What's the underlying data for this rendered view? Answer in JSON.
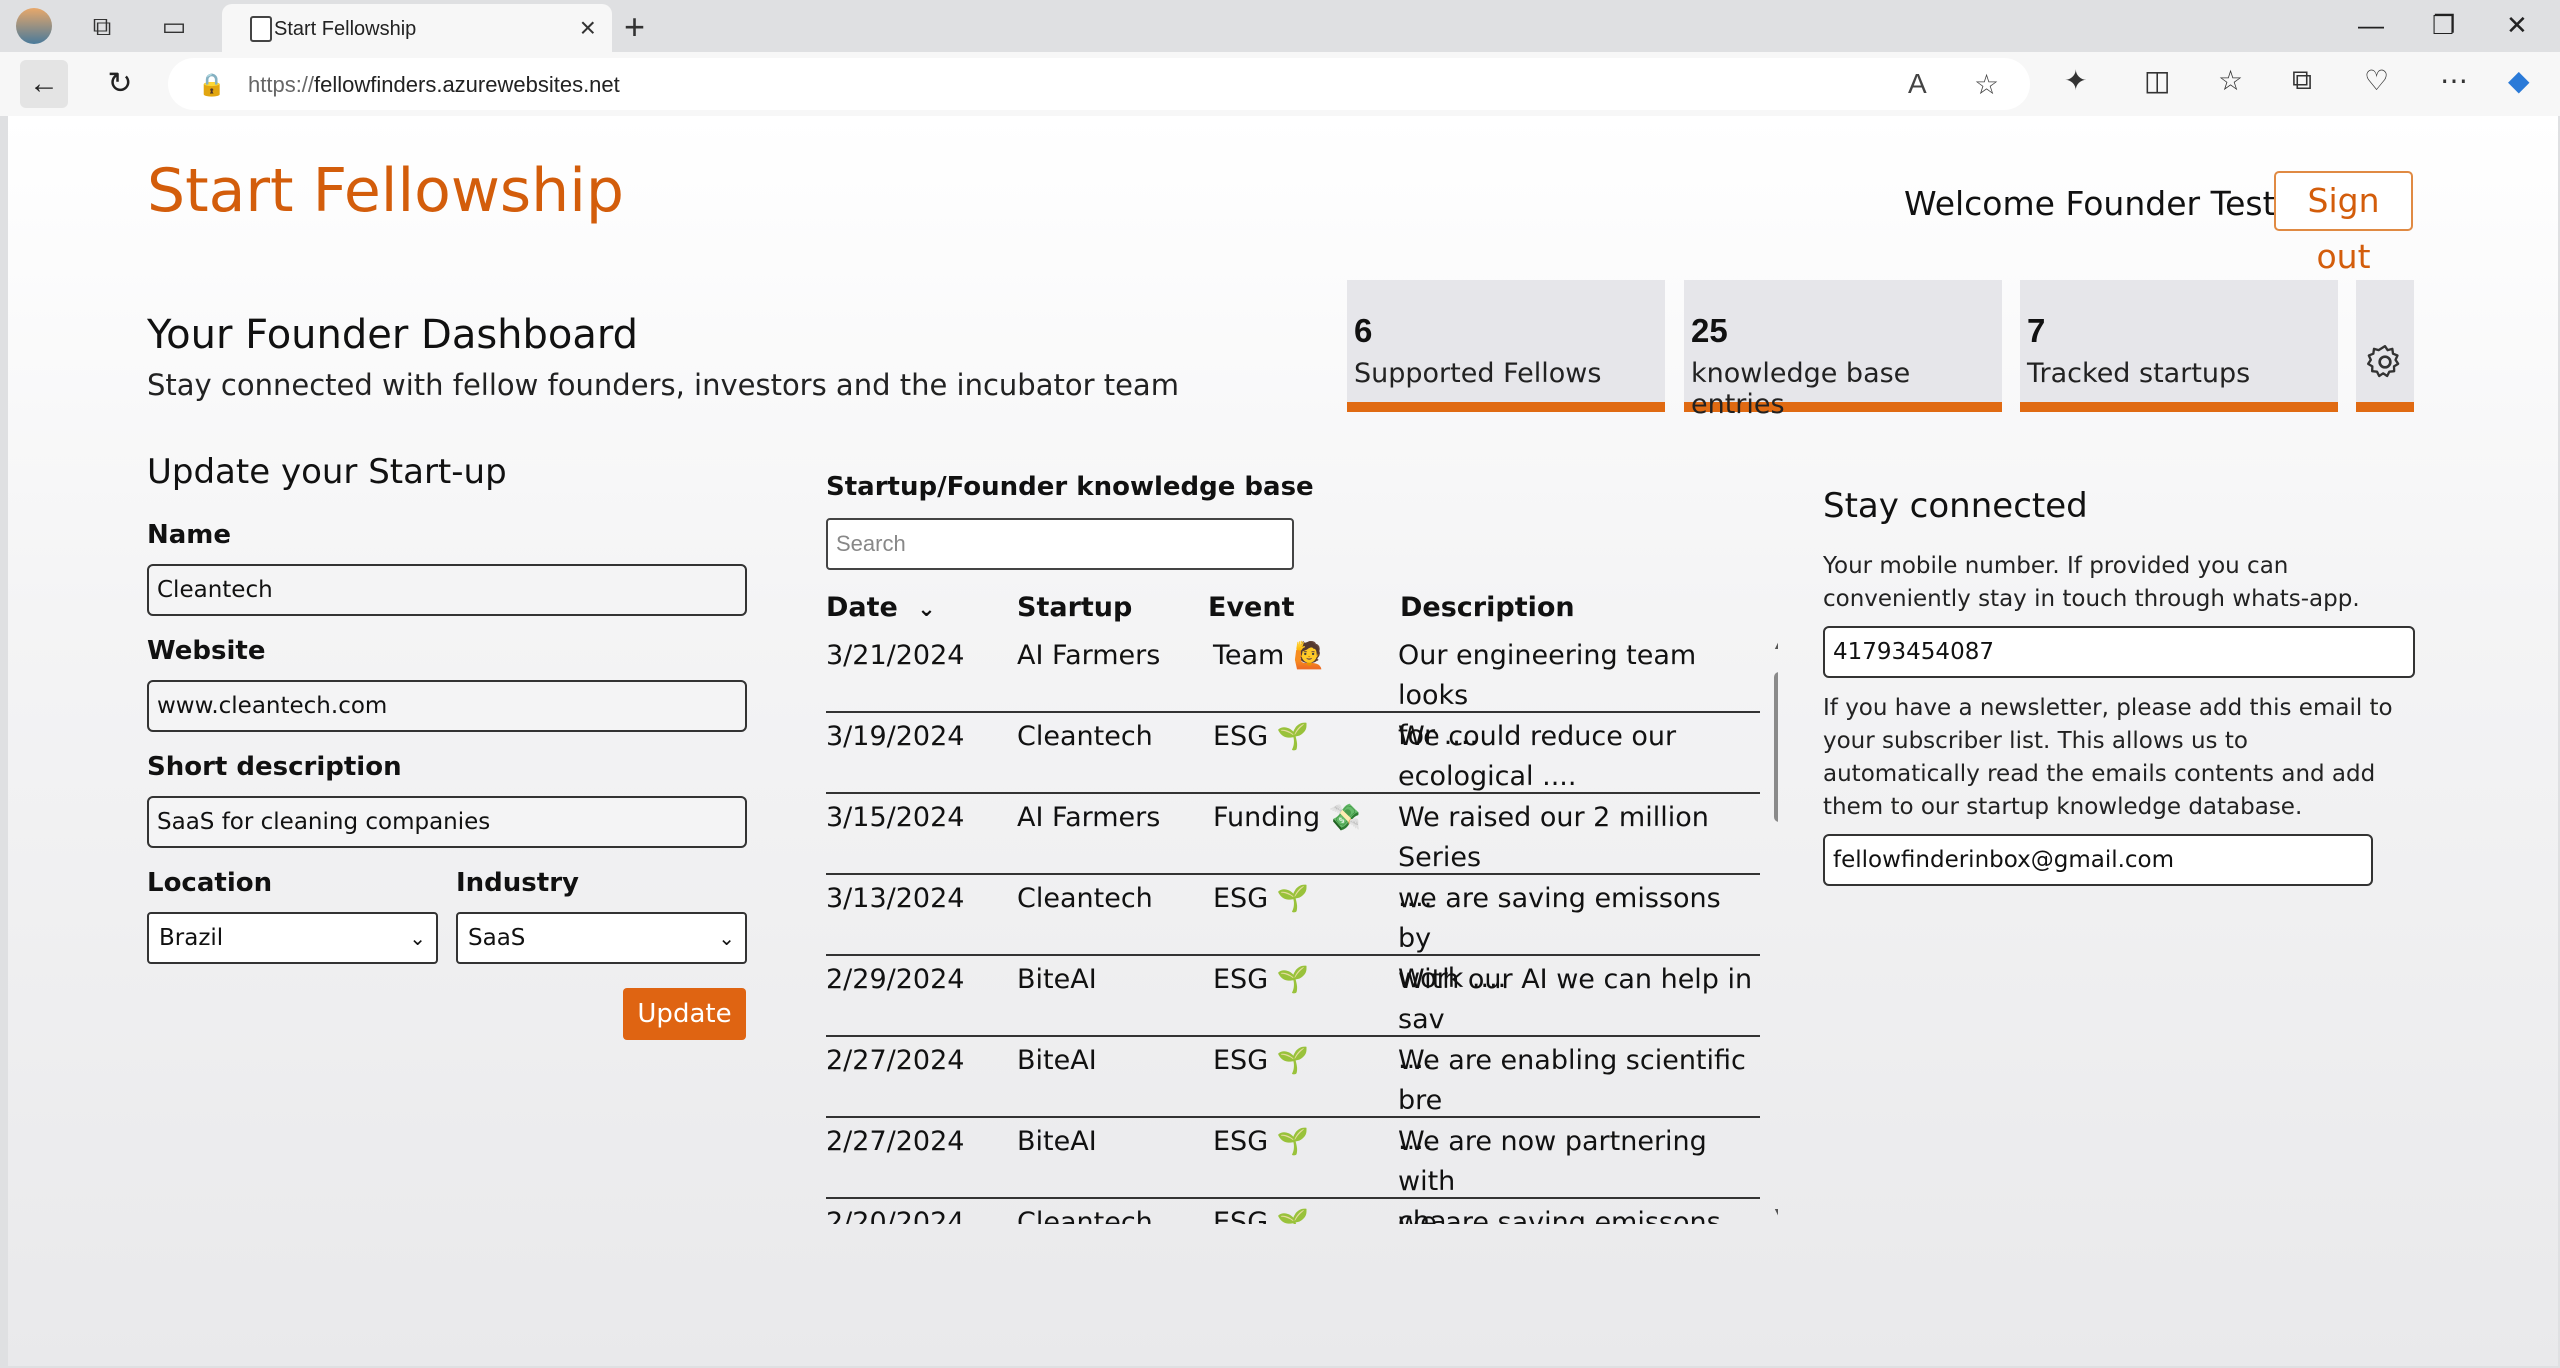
{
  "browser": {
    "tab_title": "Start Fellowship",
    "tab_close": "×",
    "new_tab": "+",
    "url_host": "fellowfinders.azurewebsites.net",
    "url_scheme": "https://"
  },
  "header": {
    "logo": "Start Fellowship",
    "welcome": "Welcome Founder Test!",
    "signout": "Sign out"
  },
  "dashboard": {
    "title": "Your Founder Dashboard",
    "subtitle": "Stay connected with fellow founders, investors and the incubator team"
  },
  "stats": [
    {
      "value": "6",
      "label": "Supported Fellows"
    },
    {
      "value": "25",
      "label": "knowledge base entries"
    },
    {
      "value": "7",
      "label": "Tracked startups"
    }
  ],
  "update_form": {
    "title": "Update your Start-up",
    "name_label": "Name",
    "name_value": "Cleantech",
    "website_label": "Website",
    "website_value": "www.cleantech.com",
    "desc_label": "Short description",
    "desc_value": "SaaS for cleaning companies",
    "location_label": "Location",
    "location_value": "Brazil",
    "industry_label": "Industry",
    "industry_value": "SaaS",
    "update_button": "Update"
  },
  "knowledge_base": {
    "title": "Startup/Founder knowledge base",
    "search_placeholder": "Search",
    "columns": {
      "date": "Date",
      "startup": "Startup",
      "event": "Event",
      "description": "Description"
    },
    "rows": [
      {
        "date": "3/21/2024",
        "startup": "AI Farmers",
        "event": "Team",
        "icon": "🙋",
        "desc1": "Our engineering team looks",
        "desc2": "for ...."
      },
      {
        "date": "3/19/2024",
        "startup": "Cleantech",
        "event": "ESG",
        "icon": "🌱",
        "desc1": "We could reduce our",
        "desc2": "ecological ...."
      },
      {
        "date": "3/15/2024",
        "startup": "AI Farmers",
        "event": "Funding",
        "icon": "💸",
        "desc1": "We raised our 2 million Series",
        "desc2": "...."
      },
      {
        "date": "3/13/2024",
        "startup": "Cleantech",
        "event": "ESG",
        "icon": "🌱",
        "desc1": "we are saving emissons by",
        "desc2": "work ...."
      },
      {
        "date": "2/29/2024",
        "startup": "BiteAI",
        "event": "ESG",
        "icon": "🌱",
        "desc1": "With our AI we can help in sav",
        "desc2": "...."
      },
      {
        "date": "2/27/2024",
        "startup": "BiteAI",
        "event": "ESG",
        "icon": "🌱",
        "desc1": "We are enabling scientific bre",
        "desc2": "...."
      },
      {
        "date": "2/27/2024",
        "startup": "BiteAI",
        "event": "ESG",
        "icon": "🌱",
        "desc1": "We are now partnering with",
        "desc2": "cha ...."
      },
      {
        "date": "2/20/2024",
        "startup": "Cleantech",
        "event": "ESG",
        "icon": "🌱",
        "desc1": "we are saving emissons by",
        "desc2": ""
      }
    ]
  },
  "stay_connected": {
    "title": "Stay connected",
    "mobile_text": "Your mobile number. If provided you can conveniently stay in touch through whats-app.",
    "mobile_value": "41793454087",
    "newsletter_text": "If you have a newsletter, please add this email to your subscriber list. This allows us to automatically read the emails contents and add them to our startup knowledge database.",
    "email_value": "fellowfinderinbox@gmail.com"
  }
}
